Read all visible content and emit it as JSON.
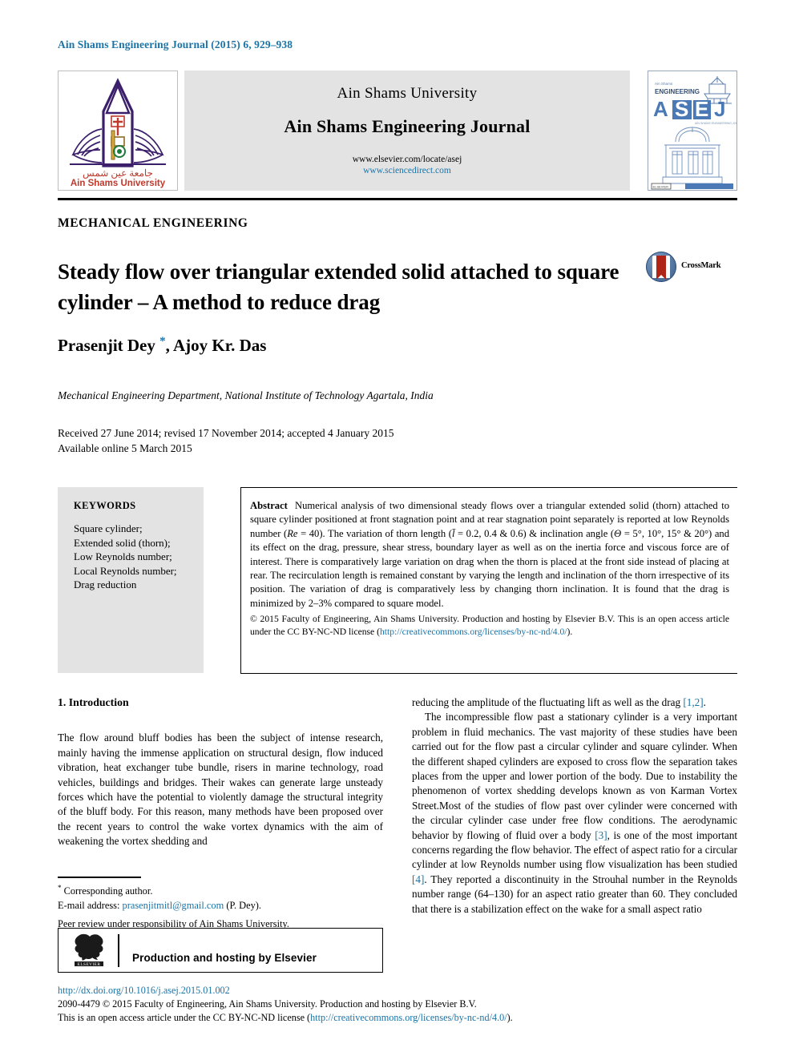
{
  "running_head": "Ain Shams Engineering Journal (2015) 6, 929–938",
  "banner": {
    "university": "Ain Shams University",
    "journal": "Ain Shams Engineering Journal",
    "url_elsevier": "www.elsevier.com/locate/asej",
    "url_sciencedirect": "www.sciencedirect.com",
    "logo_caption_ar": "جامعة عين شمس",
    "logo_caption_en": "Ain Shams University",
    "cover_top_label": "Ain Shams",
    "cover_eng_label": "ENGINEERING",
    "cover_acronym": "ASEJ",
    "cover_sub": "AIN SHAMS ENGINEERING JOURNAL"
  },
  "article": {
    "section_label": "MECHANICAL ENGINEERING",
    "title": "Steady flow over triangular extended solid attached to square cylinder – A method to reduce drag",
    "crossmark_label": "CrossMark",
    "authors": "Prasenjit Dey ",
    "authors_rest": ", Ajoy Kr. Das",
    "corresponding_star": "*",
    "affiliation": "Mechanical Engineering Department, National Institute of Technology Agartala, India",
    "history_line1": "Received 27 June 2014; revised 17 November 2014; accepted 4 January 2015",
    "history_line2": "Available online 5 March 2015"
  },
  "keywords": {
    "heading": "KEYWORDS",
    "items": [
      "Square cylinder;",
      "Extended solid (thorn);",
      "Low Reynolds number;",
      "Local Reynolds number;",
      "Drag reduction"
    ]
  },
  "abstract": {
    "heading": "Abstract",
    "text_part1": "Numerical analysis of two dimensional steady flows over a triangular extended solid (thorn) attached to square cylinder positioned at front stagnation point and at rear stagnation point separately is reported at low Reynolds number (",
    "re_italic": "Re",
    "text_part2": " = 40). The variation of thorn length (",
    "l_italic": "l̄",
    "text_part3": " = 0.2, 0.4 & 0.6) & inclination angle (",
    "theta_italic": "Θ",
    "text_part4": " = 5°, 10°, 15° & 20°) and its effect on the drag, pressure, shear stress, boundary layer as well as on the inertia force and viscous force are of interest. There is comparatively large variation on drag when the thorn is placed at the front side instead of placing at rear. The recirculation length is remained constant by varying the length and inclination of the thorn irrespective of its position. The variation of drag is comparatively less by changing thorn inclination. It is found that the drag is minimized by 2–3% compared to square model.",
    "copyright": "© 2015 Faculty of Engineering, Ain Shams University. Production and hosting by Elsevier B.V. This is an open access article under the CC BY-NC-ND license (",
    "license_url": "http://creativecommons.org/licenses/by-nc-nd/4.0/",
    "copyright_end": ")."
  },
  "body": {
    "intro_heading": "1. Introduction",
    "left_para1": "The flow around bluff bodies has been the subject of intense research, mainly having the immense application on structural design, flow induced vibration, heat exchanger tube bundle, risers in marine technology, road vehicles, buildings and bridges. Their wakes can generate large unsteady forces which have the potential to violently damage the structural integrity of the bluff body. For this reason, many methods have been proposed over the recent years to control the wake vortex dynamics with the aim of weakening the vortex shedding and",
    "right_para1_a": "reducing the amplitude of the fluctuating lift as well as the drag ",
    "right_ref_12": "[1,2]",
    "right_para1_b": ".",
    "right_para2_a": "The incompressible flow past a stationary cylinder is a very important problem in fluid mechanics. The vast majority of these studies have been carried out for the flow past a circular cylinder and square cylinder. When the different shaped cylinders are exposed to cross flow the separation takes places from the upper and lower portion of the body. Due to instability the phenomenon of vortex shedding develops known as von Karman Vortex Street.Most of the studies of flow past over cylinder were concerned with the circular cylinder case under free flow conditions. The aerodynamic behavior by flowing of fluid over a body ",
    "right_ref_3": "[3]",
    "right_para2_b": ", is one of the most important concerns regarding the flow behavior. The effect of aspect ratio for a circular cylinder at low Reynolds number using flow visualization has been studied ",
    "right_ref_4": "[4]",
    "right_para2_c": ". They reported a discontinuity in the Strouhal number in the Reynolds number range (64–130) for an aspect ratio greater than 60. They concluded that there is a stabilization effect on the wake for a small aspect ratio"
  },
  "footnote": {
    "star": "*",
    "corresponding": " Corresponding author.",
    "email_label": "E-mail address: ",
    "email": "prasenjitmitl@gmail.com",
    "email_suffix": " (P. Dey).",
    "peer_review": "Peer review under responsibility of Ain Shams University."
  },
  "elsevier_box": {
    "logo_label": "ELSEVIER",
    "text": "Production and hosting by Elsevier"
  },
  "footer": {
    "doi": "http://dx.doi.org/10.1016/j.asej.2015.01.002",
    "issn_line": "2090-4479 © 2015 Faculty of Engineering, Ain Shams University. Production and hosting by Elsevier B.V.",
    "license_pre": "This is an open access article under the CC BY-NC-ND license (",
    "license_url": "http://creativecommons.org/licenses/by-nc-nd/4.0/",
    "license_post": ")."
  },
  "colors": {
    "link": "#1a74a8",
    "banner_bg": "#e3e3e3",
    "keywords_bg": "#e3e3e3",
    "logo_purple": "#3b1f6b",
    "logo_red": "#c0392b",
    "logo_green": "#1e7a3c",
    "cover_blue": "#4a79b5"
  }
}
